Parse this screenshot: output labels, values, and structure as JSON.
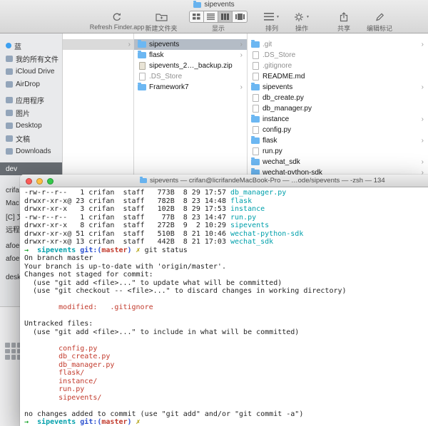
{
  "finder": {
    "title": "sipevents",
    "toolbar": {
      "refresh": "Refresh Finder.app",
      "new_folder": "新建文件夹",
      "view": "显示",
      "view_selected": "column",
      "arrange": "排列",
      "action": "操作",
      "share": "共享",
      "tags": "编辑标记"
    },
    "sidebar": [
      {
        "label": "蓝",
        "icon": "tag"
      },
      {
        "label": "我的所有文件",
        "icon": "all-files"
      },
      {
        "label": "iCloud Drive",
        "icon": "icloud"
      },
      {
        "label": "AirDrop",
        "icon": "airdrop"
      },
      {
        "label": "应用程序",
        "icon": "applications",
        "gap": 4
      },
      {
        "label": "图片",
        "icon": "pictures"
      },
      {
        "label": "Desktop",
        "icon": "desktop"
      },
      {
        "label": "文稿",
        "icon": "documents"
      },
      {
        "label": "Downloads",
        "icon": "downloads"
      },
      {
        "label": "dev",
        "selected": true,
        "gap": 7
      },
      {
        "label": "crifa",
        "gap": 12
      },
      {
        "label": "Mac"
      },
      {
        "label": "[C] 文"
      },
      {
        "label": "远程"
      },
      {
        "label": "afoe",
        "gap": 6
      },
      {
        "label": "afoe"
      },
      {
        "label": "desk",
        "gap": 8
      }
    ],
    "columns": {
      "col1": [
        {
          "label": "sipevents",
          "type": "folder",
          "chevron": true,
          "selected": true
        },
        {
          "label": "flask",
          "type": "folder",
          "chevron": true
        },
        {
          "label": "sipevents_2…_backup.zip",
          "type": "zip"
        },
        {
          "label": ".DS_Store",
          "type": "file",
          "dim": true
        },
        {
          "label": "Framework7",
          "type": "folder",
          "chevron": true
        }
      ],
      "col2": [
        {
          "label": ".git",
          "type": "folder",
          "chevron": true,
          "dim": true
        },
        {
          "label": ".DS_Store",
          "type": "file",
          "dim": true
        },
        {
          "label": ".gitignore",
          "type": "file",
          "dim": true
        },
        {
          "label": "README.md",
          "type": "file"
        },
        {
          "label": "sipevents",
          "type": "folder",
          "chevron": true
        },
        {
          "label": "db_create.py",
          "type": "file"
        },
        {
          "label": "db_manager.py",
          "type": "file"
        },
        {
          "label": "instance",
          "type": "folder",
          "chevron": true
        },
        {
          "label": "config.py",
          "type": "file"
        },
        {
          "label": "flask",
          "type": "folder",
          "chevron": true
        },
        {
          "label": "run.py",
          "type": "file"
        },
        {
          "label": "wechat_sdk",
          "type": "folder",
          "chevron": true
        },
        {
          "label": "wechat-python-sdk",
          "type": "folder",
          "chevron": true
        }
      ]
    }
  },
  "terminal": {
    "title": "sipevents — crifan@licrifandeMacBook-Pro — …ode/sipevents — -zsh — 134",
    "lines": [
      {
        "s": [
          {
            "t": "-rw-r--r--   1 crifan  staff   773B  8 29 17:57 "
          },
          {
            "t": "db_manager.py",
            "c": "cy"
          }
        ]
      },
      {
        "s": [
          {
            "t": "drwxr-xr-x@ 23 crifan  staff   782B  8 23 14:48 "
          },
          {
            "t": "flask",
            "c": "cy"
          }
        ]
      },
      {
        "s": [
          {
            "t": "drwxr-xr-x   3 crifan  staff   102B  8 29 17:53 "
          },
          {
            "t": "instance",
            "c": "cy"
          }
        ]
      },
      {
        "s": [
          {
            "t": "-rw-r--r--   1 crifan  staff    77B  8 23 14:47 "
          },
          {
            "t": "run.py",
            "c": "cy"
          }
        ]
      },
      {
        "s": [
          {
            "t": "drwxr-xr-x   8 crifan  staff   272B  9  2 10:29 "
          },
          {
            "t": "sipevents",
            "c": "cy"
          }
        ]
      },
      {
        "s": [
          {
            "t": "drwxr-xr-x@ 51 crifan  staff   510B  8 21 10:46 "
          },
          {
            "t": "wechat-python-sdk",
            "c": "cy"
          }
        ]
      },
      {
        "s": [
          {
            "t": "drwxr-xr-x@ 13 crifan  staff   442B  8 21 17:03 "
          },
          {
            "t": "wechat_sdk",
            "c": "cy"
          }
        ]
      },
      {
        "s": [
          {
            "t": "→  ",
            "c": "gr",
            "b": true
          },
          {
            "t": "sipevents ",
            "c": "cy",
            "b": true
          },
          {
            "t": "git:(",
            "c": "bl",
            "b": true
          },
          {
            "t": "master",
            "c": "rd",
            "b": true
          },
          {
            "t": ") ",
            "c": "bl",
            "b": true
          },
          {
            "t": "✗ ",
            "c": "yl",
            "b": true
          },
          {
            "t": "git status"
          }
        ]
      },
      {
        "s": [
          {
            "t": "On branch master"
          }
        ]
      },
      {
        "s": [
          {
            "t": "Your branch is up-to-date with 'origin/master'."
          }
        ]
      },
      {
        "s": [
          {
            "t": "Changes not staged for commit:"
          }
        ]
      },
      {
        "s": [
          {
            "t": "  (use \"git add <file>...\" to update what will be committed)"
          }
        ]
      },
      {
        "s": [
          {
            "t": "  (use \"git checkout -- <file>...\" to discard changes in working directory)"
          }
        ]
      },
      {
        "s": [
          {
            "t": ""
          }
        ]
      },
      {
        "s": [
          {
            "t": "        modified:   .gitignore",
            "c": "rd"
          }
        ]
      },
      {
        "s": [
          {
            "t": ""
          }
        ]
      },
      {
        "s": [
          {
            "t": "Untracked files:"
          }
        ]
      },
      {
        "s": [
          {
            "t": "  (use \"git add <file>...\" to include in what will be committed)"
          }
        ]
      },
      {
        "s": [
          {
            "t": ""
          }
        ]
      },
      {
        "s": [
          {
            "t": "        config.py",
            "c": "rd"
          }
        ]
      },
      {
        "s": [
          {
            "t": "        db_create.py",
            "c": "rd"
          }
        ]
      },
      {
        "s": [
          {
            "t": "        db_manager.py",
            "c": "rd"
          }
        ]
      },
      {
        "s": [
          {
            "t": "        flask/",
            "c": "rd"
          }
        ]
      },
      {
        "s": [
          {
            "t": "        instance/",
            "c": "rd"
          }
        ]
      },
      {
        "s": [
          {
            "t": "        run.py",
            "c": "rd"
          }
        ]
      },
      {
        "s": [
          {
            "t": "        sipevents/",
            "c": "rd"
          }
        ]
      },
      {
        "s": [
          {
            "t": ""
          }
        ]
      },
      {
        "s": [
          {
            "t": "no changes added to commit (use \"git add\" and/or \"git commit -a\")"
          }
        ]
      },
      {
        "s": [
          {
            "t": "→  ",
            "c": "gr",
            "b": true
          },
          {
            "t": "sipevents ",
            "c": "cy",
            "b": true
          },
          {
            "t": "git:(",
            "c": "bl",
            "b": true
          },
          {
            "t": "master",
            "c": "rd",
            "b": true
          },
          {
            "t": ") ",
            "c": "bl",
            "b": true
          },
          {
            "t": "✗",
            "c": "yl",
            "b": true
          }
        ]
      }
    ]
  }
}
